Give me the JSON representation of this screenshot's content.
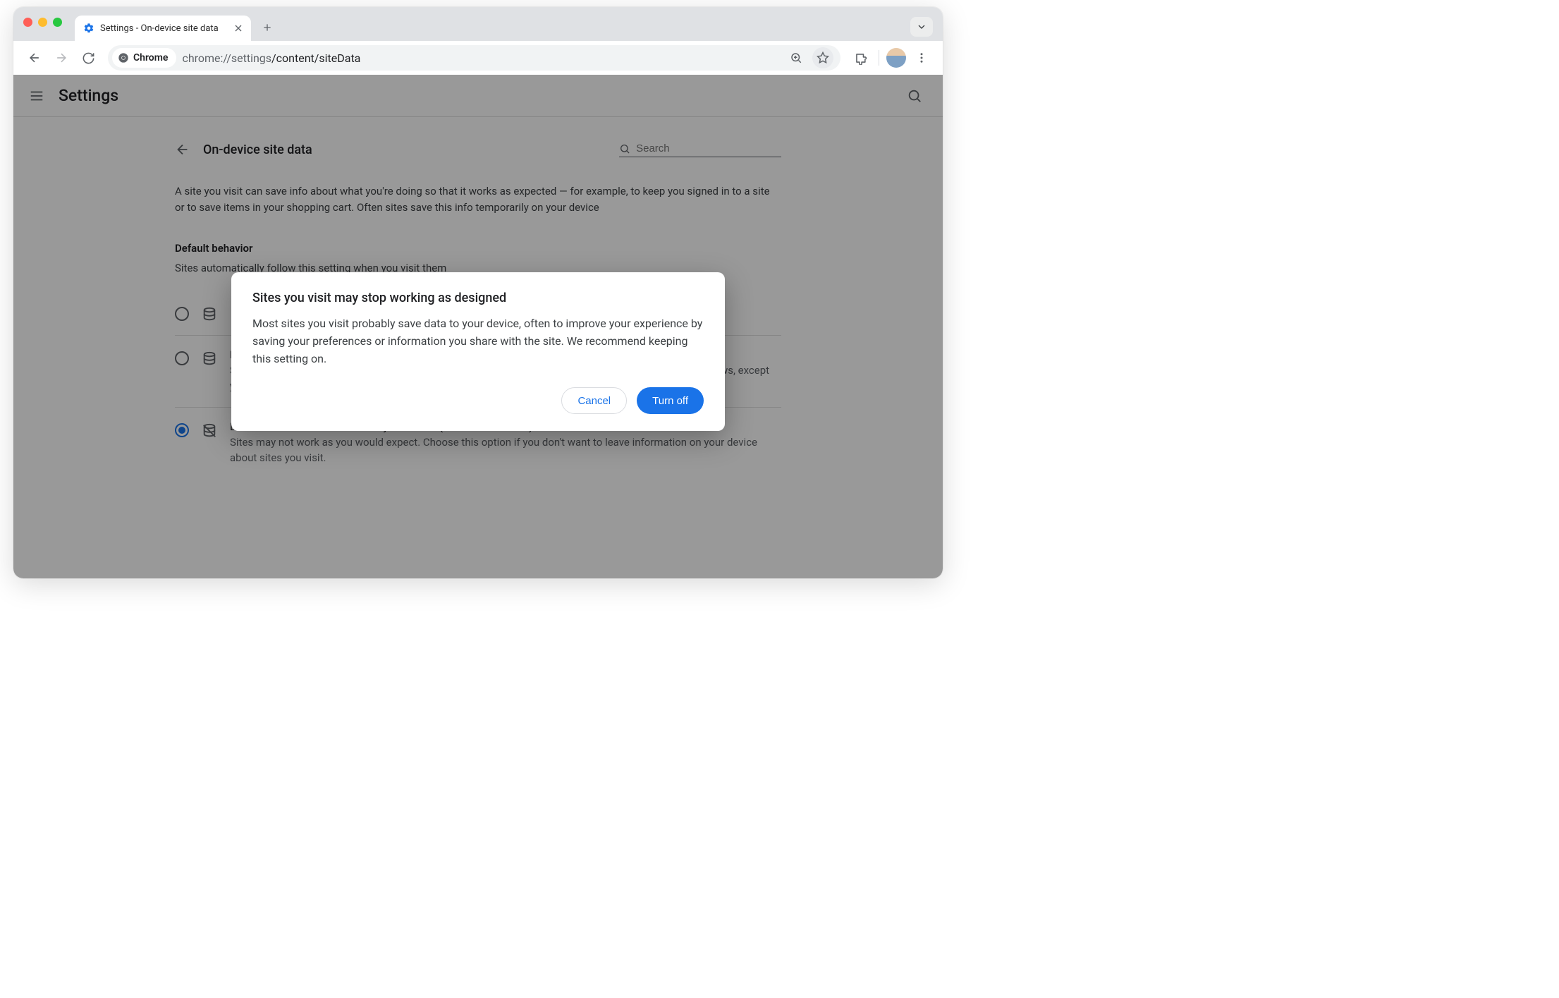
{
  "tab": {
    "title": "Settings - On-device site data"
  },
  "omnibox": {
    "chip_label": "Chrome",
    "url_prefix": "chrome://settings",
    "url_path": "/content/siteData"
  },
  "header": {
    "title": "Settings"
  },
  "page": {
    "title": "On-device site data",
    "search_placeholder": "Search",
    "description": "A site you visit can save info about what you're doing so that it works as expected — for example, to keep you signed in to a site or to save items in your shopping cart. Often sites save this info temporarily on your device",
    "section_label": "Default behavior",
    "section_sub": "Sites automatically follow this setting when you visit them",
    "options": [
      {
        "title": "",
        "sub": ""
      },
      {
        "title": "Delete data sites have saved to your device when you close all windows",
        "sub": "Sites will probably work as expected. You'll be signed out of most sites when you close all Chrome windows, except your Google Account if you're signed in to Chrome."
      },
      {
        "title": "Don't allow sites to save data on your device (not recommended)",
        "sub": "Sites may not work as you would expect. Choose this option if you don't want to leave information on your device about sites you visit."
      }
    ]
  },
  "dialog": {
    "title": "Sites you visit may stop working as designed",
    "body": "Most sites you visit probably save data to your device, often to improve your experience by saving your preferences or information you share with the site. We recommend keeping this setting on.",
    "cancel": "Cancel",
    "confirm": "Turn off"
  }
}
